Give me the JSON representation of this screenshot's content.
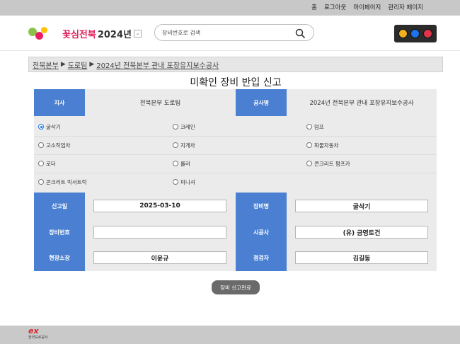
{
  "top_nav": [
    "홈",
    "로그아웃",
    "마이페이지",
    "관리자 페이지"
  ],
  "logo": {
    "text": "꽃심전북",
    "year": "2024년",
    "badge_icon": "flower-badge-icon"
  },
  "search": {
    "placeholder": "장비번호로 검색",
    "value": ""
  },
  "traffic_light": {
    "colors": [
      "#f2b01e",
      "#1e73e8",
      "#e0344a"
    ]
  },
  "breadcrumb": [
    "전북본부",
    "도로팀",
    "2024년 전북본부 관내 포장유지보수공사"
  ],
  "page_title": "미확인 장비 반입 신고",
  "header_fields": {
    "branch_label": "지사",
    "branch_value": "전북본부 도로팀",
    "project_label": "공사명",
    "project_value": "2024년 전북본부 관내 포장유지보수공사"
  },
  "equipment_types": [
    {
      "label": "굴삭기",
      "checked": true
    },
    {
      "label": "크레인",
      "checked": false
    },
    {
      "label": "덤프",
      "checked": false
    },
    {
      "label": "고소작업차",
      "checked": false
    },
    {
      "label": "지게차",
      "checked": false
    },
    {
      "label": "화물자동차",
      "checked": false
    },
    {
      "label": "로더",
      "checked": false
    },
    {
      "label": "롤러",
      "checked": false
    },
    {
      "label": "콘크리트 펌프카",
      "checked": false
    },
    {
      "label": "콘크리트 믹서트럭",
      "checked": false
    },
    {
      "label": "피니셔",
      "checked": false
    }
  ],
  "fields": {
    "report_date_label": "신고일",
    "report_date_value": "2025-03-10",
    "equipment_name_label": "장비명",
    "equipment_name_value": "굴삭기",
    "equipment_number_label": "장비번호",
    "equipment_number_value": "",
    "contractor_label": "시공사",
    "contractor_value": "(유) 금영토건",
    "site_manager_label": "현장소장",
    "site_manager_value": "이윤규",
    "inspector_label": "점검자",
    "inspector_value": "김길동"
  },
  "submit_label": "장비 신고완료",
  "footer": {
    "logo_mark": "ex",
    "logo_name": "한국도로공사"
  },
  "colors": {
    "accent": "#4a7fd1",
    "topbar": "#c8c8c8",
    "form_bg": "#ebebeb",
    "button": "#6a6a6a"
  }
}
